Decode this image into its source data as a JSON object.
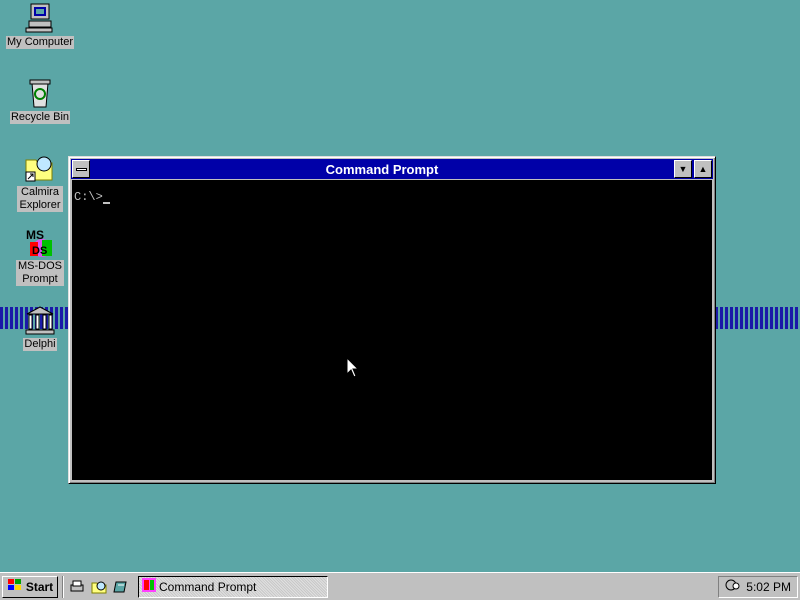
{
  "desktop": {
    "icons": [
      {
        "label": "My Computer"
      },
      {
        "label": "Recycle Bin"
      },
      {
        "label": "Calmira Explorer"
      },
      {
        "label": "MS-DOS Prompt"
      },
      {
        "label": "Delphi"
      }
    ]
  },
  "window": {
    "title": "Command Prompt",
    "prompt": "C:\\>"
  },
  "taskbar": {
    "start_label": "Start",
    "task_label": "Command Prompt",
    "clock": "5:02 PM"
  },
  "colors": {
    "desktop": "#5ba6a6",
    "titlebar": "#0000a8",
    "console_bg": "#000000",
    "chrome": "#c0c0c0"
  }
}
